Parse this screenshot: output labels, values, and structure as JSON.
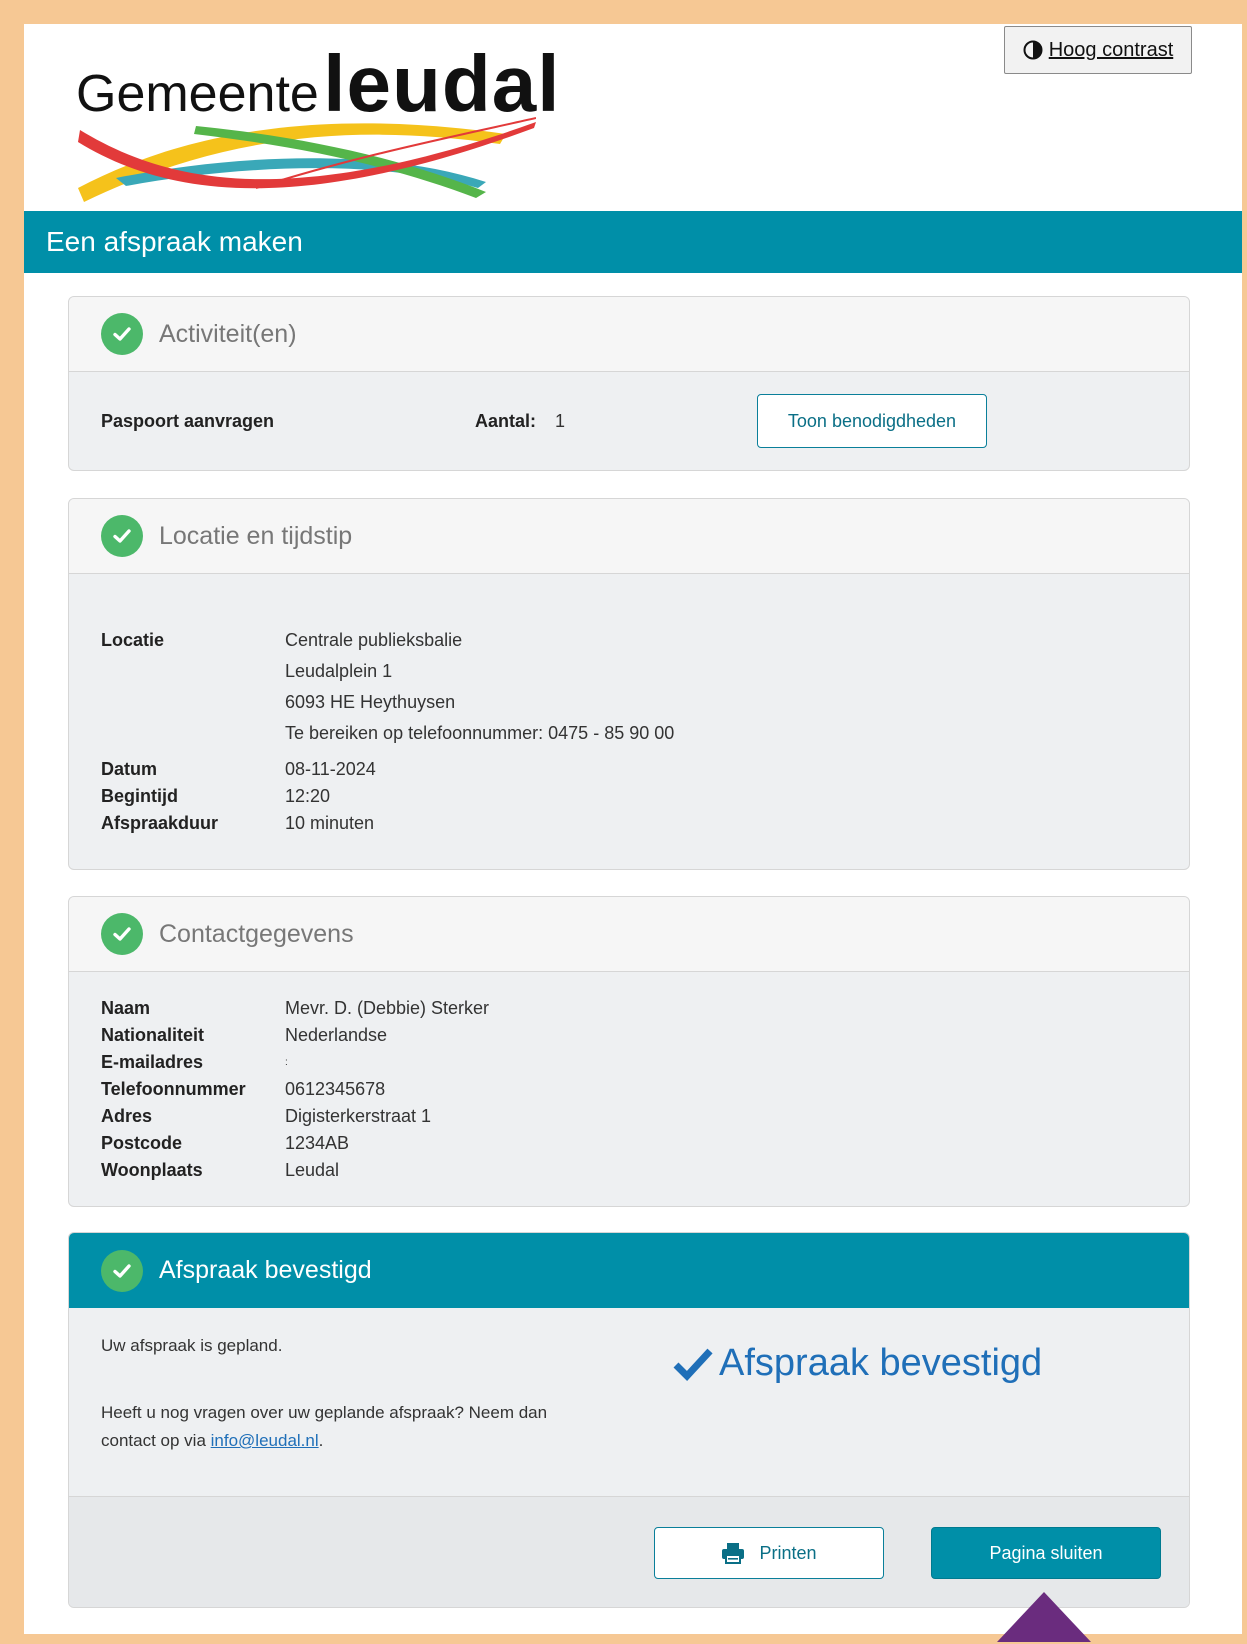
{
  "header": {
    "logo_prefix": "Gemeente",
    "logo_name": "leudal",
    "contrast_button": "Hoog contrast"
  },
  "page_title": "Een afspraak maken",
  "activities": {
    "title": "Activiteit(en)",
    "item": "Paspoort aanvragen",
    "count_label": "Aantal:",
    "count_value": "1",
    "requirements_button": "Toon benodigdheden"
  },
  "location": {
    "title": "Locatie en tijdstip",
    "location_label": "Locatie",
    "location_lines": [
      "Centrale publieksbalie",
      "Leudalplein 1",
      "6093 HE Heythuysen",
      "Te bereiken op telefoonnummer: 0475 - 85 90 00"
    ],
    "date_label": "Datum",
    "date_value": "08-11-2024",
    "start_label": "Begintijd",
    "start_value": "12:20",
    "duration_label": "Afspraakduur",
    "duration_value": "10 minuten"
  },
  "contact": {
    "title": "Contactgegevens",
    "fields": [
      {
        "label": "Naam",
        "value": "Mevr. D. (Debbie) Sterker"
      },
      {
        "label": "Nationaliteit",
        "value": "Nederlandse"
      },
      {
        "label": "E-mailadres",
        "value": ":"
      },
      {
        "label": "Telefoonnummer",
        "value": "0612345678"
      },
      {
        "label": "Adres",
        "value": "Digisterkerstraat 1"
      },
      {
        "label": "Postcode",
        "value": "1234AB"
      },
      {
        "label": "Woonplaats",
        "value": "Leudal"
      }
    ]
  },
  "confirmation": {
    "title": "Afspraak bevestigd",
    "planned_text": "Uw afspraak is gepland.",
    "question_text": "Heeft u nog vragen over uw geplande afspraak? Neem dan",
    "contact_prefix": "contact op via",
    "email": "info@leudal.nl",
    "contact_suffix": ".",
    "big_status": "Afspraak bevestigd",
    "print_button": "Printen",
    "close_button": "Pagina sluiten"
  },
  "colors": {
    "accent": "#008fa8",
    "check_green": "#4cb86a",
    "frame": "#f6c894",
    "arrow": "#6a2c7e",
    "status_blue": "#1f6fb8"
  }
}
